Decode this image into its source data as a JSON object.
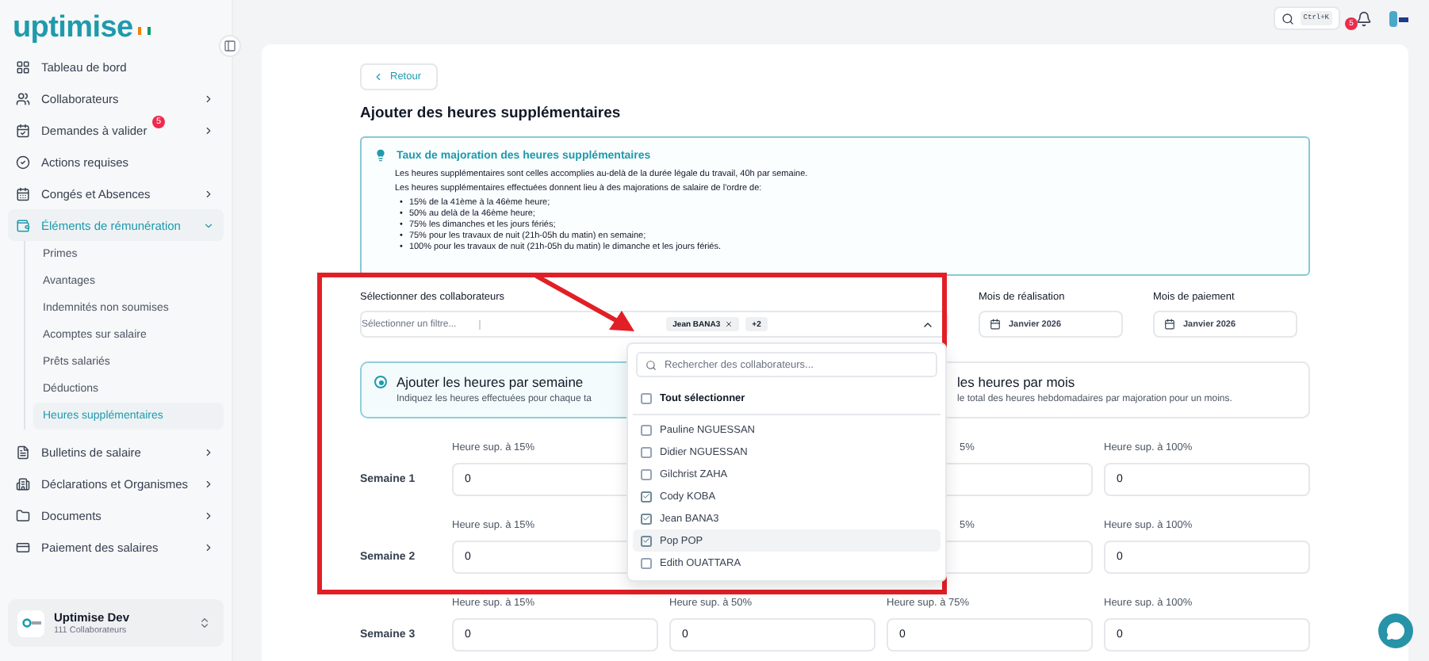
{
  "sidebar": {
    "logo": "uptimise",
    "items": [
      {
        "label": "Tableau de bord",
        "kind": "link",
        "selected": false
      },
      {
        "label": "Collaborateurs",
        "kind": "group",
        "expanded": false,
        "selected": false
      },
      {
        "label": "Demandes à valider",
        "kind": "group",
        "expanded": false,
        "selected": false,
        "badge": "5"
      },
      {
        "label": "Actions requises",
        "kind": "link",
        "selected": false
      },
      {
        "label": "Congés et Absences",
        "kind": "group",
        "expanded": false,
        "selected": false
      },
      {
        "label": "Éléments de rémunération",
        "kind": "group",
        "expanded": true,
        "selected": true,
        "children": [
          {
            "label": "Primes",
            "selected": false
          },
          {
            "label": "Avantages",
            "selected": false
          },
          {
            "label": "Indemnités non soumises",
            "selected": false
          },
          {
            "label": "Acomptes sur salaire",
            "selected": false
          },
          {
            "label": "Prêts salariés",
            "selected": false
          },
          {
            "label": "Déductions",
            "selected": false
          },
          {
            "label": "Heures supplémentaires",
            "selected": true
          }
        ]
      },
      {
        "label": "Bulletins de salaire",
        "kind": "group",
        "expanded": false,
        "selected": false
      },
      {
        "label": "Déclarations et Organismes",
        "kind": "group",
        "expanded": false,
        "selected": false
      },
      {
        "label": "Documents",
        "kind": "group",
        "expanded": false,
        "selected": false
      },
      {
        "label": "Paiement des salaires",
        "kind": "group",
        "expanded": false,
        "selected": false
      }
    ],
    "org": {
      "name": "Uptimise Dev",
      "subtitle": "111 Collaborateurs"
    }
  },
  "topbar": {
    "shortcut": "Ctrl+K",
    "notification_count": "5"
  },
  "back_button": "Retour",
  "title": "Ajouter des heures supplémentaires",
  "info": {
    "title": "Taux de majoration des heures supplémentaires",
    "paragraphs": [
      "Les heures supplémentaires sont celles accomplies au-delà de la durée légale du travail, 40h par semaine.",
      "Les heures supplémentaires effectuées donnent lieu à des majorations de salaire de l'ordre de:"
    ],
    "bullets": [
      {
        "marker": "•",
        "text": "15% de la 41ème à la 46ème heure;"
      },
      {
        "marker": "•",
        "text": "50% au delà de la 46ème heure;"
      },
      {
        "marker": "•",
        "text": "75% les dimanches et les jours fériés;"
      },
      {
        "marker": "•",
        "text": "75% pour les travaux de nuit (21h-05h du matin) en semaine;"
      },
      {
        "marker": "•",
        "text": "100% pour les travaux de nuit (21h-05h du matin) le dimanche et les jours fériés."
      }
    ]
  },
  "collaborators": {
    "label": "Sélectionner des collaborateurs",
    "placeholder": "Sélectionner un filtre...",
    "expanded": true,
    "tags": [
      {
        "label": "Jean BANA3",
        "removable": true
      },
      {
        "label": "+2",
        "removable": false
      }
    ]
  },
  "months": [
    {
      "label": "Mois de réalisation",
      "value": "Janvier 2026"
    },
    {
      "label": "Mois de paiement",
      "value": "Janvier 2026"
    }
  ],
  "modes": [
    {
      "title": "Ajouter les heures par semaine",
      "description": "Indiquez les heures effectuées pour chaque ta",
      "selected": true
    },
    {
      "title": "les heures par mois",
      "description": "le total des heures hebdomadaires par majoration pour un moins.",
      "selected": false
    }
  ],
  "weeks": [
    {
      "label": "Semaine 1",
      "fields": [
        {
          "kind": "full",
          "label": "Heure sup. à 15%",
          "value": "0"
        },
        {
          "kind": "hidden"
        },
        {
          "kind": "partial",
          "label": "5%"
        },
        {
          "kind": "full",
          "label": "Heure sup. à 100%",
          "value": "0"
        }
      ]
    },
    {
      "label": "Semaine 2",
      "fields": [
        {
          "kind": "full",
          "label": "Heure sup. à 15%",
          "value": "0"
        },
        {
          "kind": "hidden"
        },
        {
          "kind": "partial",
          "label": "5%"
        },
        {
          "kind": "full",
          "label": "Heure sup. à 100%",
          "value": "0"
        }
      ]
    },
    {
      "label": "Semaine 3",
      "fields": [
        {
          "kind": "full",
          "label": "Heure sup. à 15%",
          "value": "0"
        },
        {
          "kind": "full",
          "label": "Heure sup. à 50%",
          "value": "0"
        },
        {
          "kind": "full",
          "label": "Heure sup. à 75%",
          "value": "0"
        },
        {
          "kind": "full",
          "label": "Heure sup. à 100%",
          "value": "0"
        }
      ]
    }
  ],
  "dropdown": {
    "search_placeholder": "Rechercher des collaborateurs...",
    "select_all": {
      "label": "Tout sélectionner",
      "checked": false
    },
    "options": [
      {
        "label": "Pauline NGUESSAN",
        "checked": false,
        "highlighted": false
      },
      {
        "label": "Didier NGUESSAN",
        "checked": false,
        "highlighted": false
      },
      {
        "label": "Gilchrist ZAHA",
        "checked": false,
        "highlighted": false
      },
      {
        "label": "Cody KOBA",
        "checked": true,
        "highlighted": false
      },
      {
        "label": "Jean BANA3",
        "checked": true,
        "highlighted": false
      },
      {
        "label": "Pop POP",
        "checked": true,
        "highlighted": true
      },
      {
        "label": "Edith OUATTARA",
        "checked": false,
        "highlighted": false
      }
    ]
  }
}
